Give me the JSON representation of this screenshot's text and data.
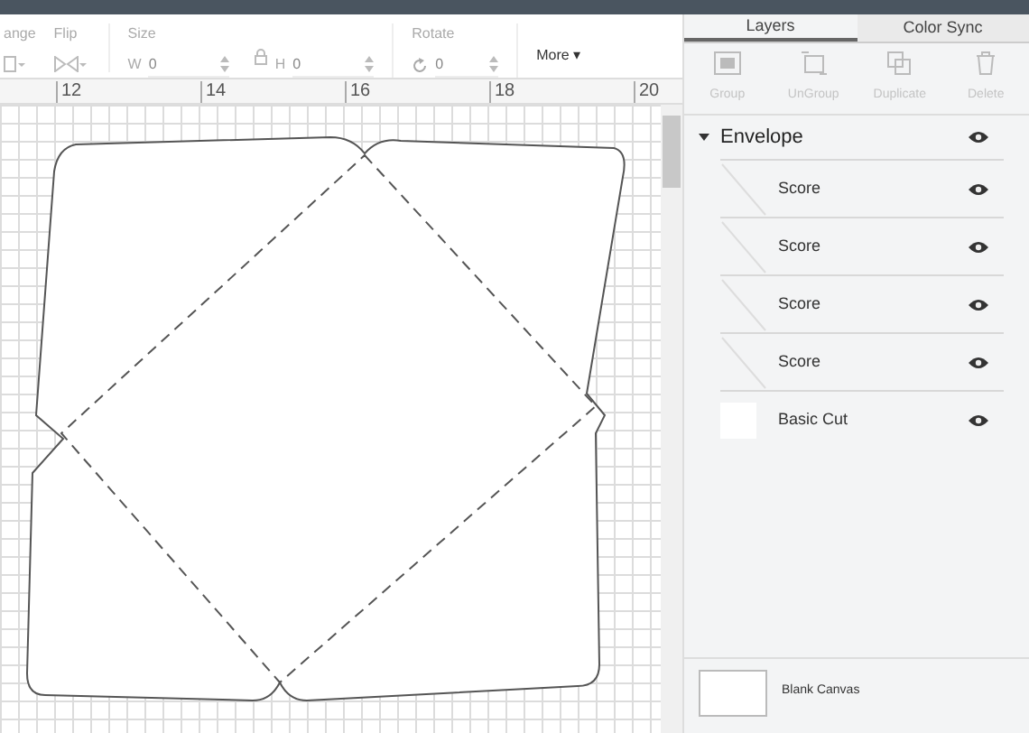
{
  "toolbar": {
    "arrange_label": "ange",
    "flip_label": "Flip",
    "size_label": "Size",
    "width": {
      "label": "W",
      "value": "0"
    },
    "height": {
      "label": "H",
      "value": "0"
    },
    "rotate_label": "Rotate",
    "rotate": {
      "value": "0"
    },
    "more": "More ▾"
  },
  "ruler": {
    "marks": [
      "12",
      "14",
      "16",
      "18",
      "20"
    ]
  },
  "panel": {
    "tabs": [
      {
        "label": "Layers",
        "selected": true
      },
      {
        "label": "Color Sync",
        "selected": false
      }
    ],
    "actions": [
      {
        "label": "Group",
        "kind": "group",
        "disabled": true
      },
      {
        "label": "UnGroup",
        "kind": "ungroup",
        "disabled": true
      },
      {
        "label": "Duplicate",
        "kind": "duplicate",
        "disabled": true
      },
      {
        "label": "Delete",
        "kind": "delete",
        "disabled": true
      }
    ],
    "layers": {
      "name": "Envelope",
      "expanded": true,
      "visible": true,
      "children": [
        {
          "name": "Score",
          "kind": "score",
          "visible": true
        },
        {
          "name": "Score",
          "kind": "score",
          "visible": true
        },
        {
          "name": "Score",
          "kind": "score",
          "visible": true
        },
        {
          "name": "Score",
          "kind": "score",
          "visible": true
        },
        {
          "name": "Basic Cut",
          "kind": "cut",
          "visible": true
        }
      ]
    },
    "canvas": {
      "label": "Blank Canvas"
    }
  }
}
